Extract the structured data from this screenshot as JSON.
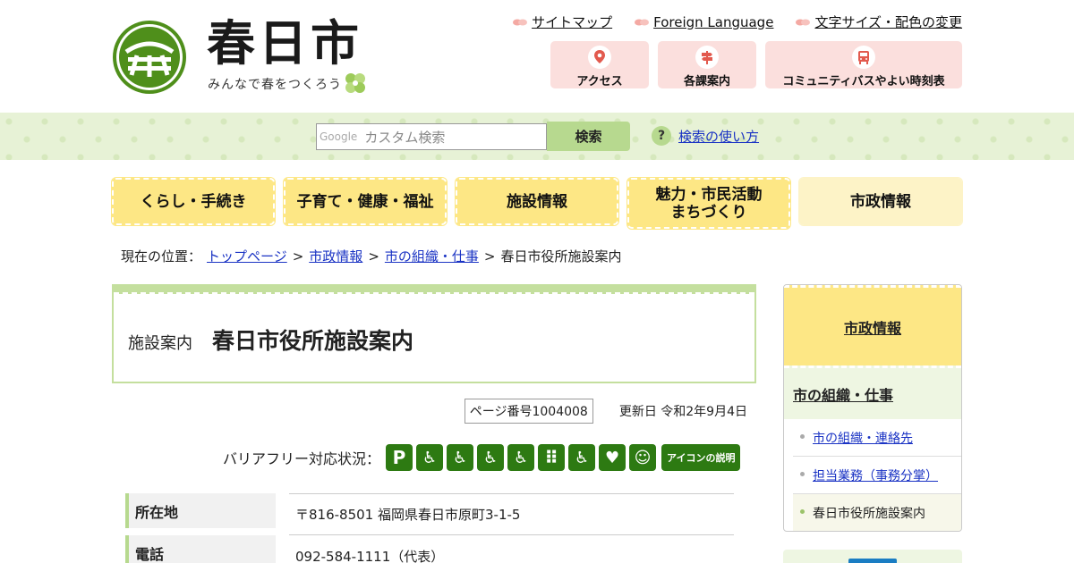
{
  "site": {
    "title": "春日市",
    "tagline": "みんなで春をつくろう",
    "brand_green": "#4f8f1b",
    "emblem_icon": "kasuga-emblem-icon"
  },
  "utility_links": [
    {
      "label": "サイトマップ",
      "icon": "leaf-icon"
    },
    {
      "label": "Foreign Language",
      "icon": "leaf-icon"
    },
    {
      "label": "文字サイズ・配色の変更",
      "icon": "leaf-icon"
    }
  ],
  "quick_buttons": [
    {
      "label": "アクセス",
      "icon": "map-pin-icon"
    },
    {
      "label": "各課案内",
      "icon": "signpost-icon"
    },
    {
      "label": "コミュニティバスやよい時刻表",
      "icon": "bus-icon"
    }
  ],
  "search": {
    "google_label": "Google",
    "placeholder": "カスタム検索",
    "button_label": "検索",
    "help_label": "検索の使い方",
    "help_icon": "?"
  },
  "global_nav": [
    {
      "label": "くらし・手続き"
    },
    {
      "label": "子育て・健康・福祉"
    },
    {
      "label": "施設情報"
    },
    {
      "label": "魅力・市民活動\nまちづくり"
    },
    {
      "label": "市政情報"
    }
  ],
  "breadcrumb": {
    "prefix": "現在の位置：",
    "items": [
      "トップページ",
      "市政情報",
      "市の組織・仕事"
    ],
    "separator": ">",
    "current": "春日市役所施設案内"
  },
  "page": {
    "category": "施設案内",
    "title": "春日市役所施設案内",
    "page_number": "ページ番号1004008",
    "updated": "更新日 令和2年9月4日"
  },
  "barrier_free": {
    "label": "バリアフリー対応状況：",
    "icons": [
      {
        "name": "parking-icon",
        "glyph": "P"
      },
      {
        "name": "accessible-parking-icon",
        "glyph": "♿"
      },
      {
        "name": "accessible-wc-icon",
        "glyph": "♿"
      },
      {
        "name": "ramp-icon",
        "glyph": "♿"
      },
      {
        "name": "elevator-icon",
        "glyph": "♿"
      },
      {
        "name": "braille-block-icon",
        "glyph": "⠿"
      },
      {
        "name": "wheelchair-rental-icon",
        "glyph": "♿"
      },
      {
        "name": "aed-icon",
        "glyph": "♥"
      },
      {
        "name": "nursing-room-icon",
        "glyph": "☺"
      }
    ],
    "explain_label": "アイコンの説明"
  },
  "info_table": [
    {
      "th": "所在地",
      "td": "〒816-8501 福岡県春日市原町3-1-5"
    },
    {
      "th": "電話",
      "td": "092-584-1111（代表）"
    }
  ],
  "side_nav": {
    "heading": "市政情報",
    "sub_heading": "市の組織・仕事",
    "items": [
      {
        "label": "市の組織・連絡先"
      },
      {
        "label": "担当業務（事務分掌）"
      },
      {
        "label": "春日市役所施設案内"
      }
    ]
  }
}
